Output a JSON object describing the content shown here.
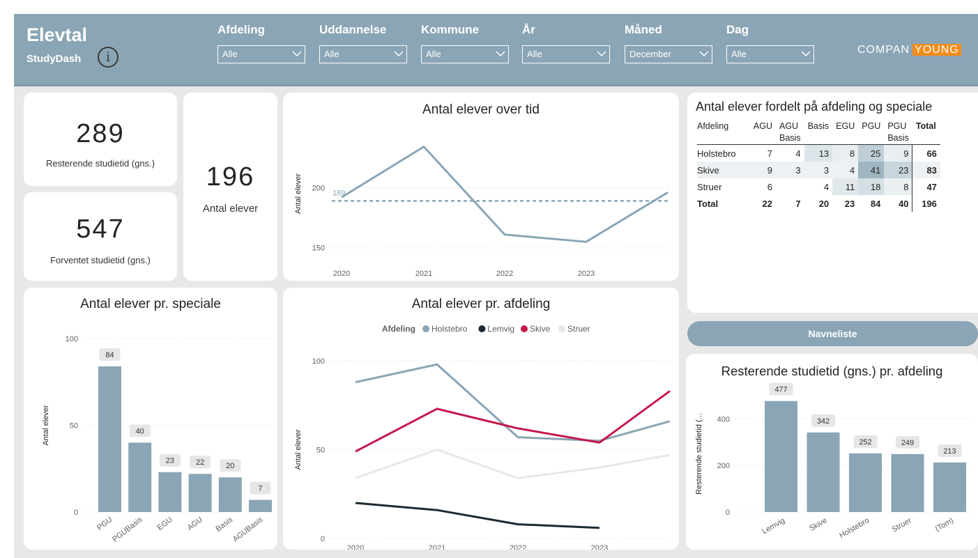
{
  "header": {
    "title": "Elevtal",
    "subtitle": "StudyDash",
    "info_icon": "i",
    "logo_part1": "COMPAN",
    "logo_part2": "YOUNG",
    "filters": [
      {
        "label": "Afdeling",
        "value": "Alle"
      },
      {
        "label": "Uddannelse",
        "value": "Alle"
      },
      {
        "label": "Kommune",
        "value": "Alle"
      },
      {
        "label": "År",
        "value": "Alle"
      },
      {
        "label": "Måned",
        "value": "December"
      },
      {
        "label": "Dag",
        "value": "Alle"
      }
    ]
  },
  "kpis": {
    "remaining": {
      "value": "289",
      "label": "Resterende studietid (gns.)"
    },
    "expected": {
      "value": "547",
      "label": "Forventet studietid (gns.)"
    },
    "students": {
      "value": "196",
      "label": "Antal elever"
    }
  },
  "colors": {
    "header": "#8aa5b5",
    "bar": "#8aa5b5",
    "holstebro": "#8aa5b5",
    "lemvig": "#1b2a32",
    "skive": "#c4174a",
    "struer": "#e3e9e9"
  },
  "matrix": {
    "title": "Antal elever fordelt på afdeling og speciale",
    "row_header": "Afdeling",
    "columns": [
      "AGU",
      "AGU Basis",
      "Basis",
      "EGU",
      "PGU",
      "PGU Basis",
      "Total"
    ],
    "rows": [
      {
        "name": "Holstebro",
        "values": [
          "7",
          "4",
          "13",
          "8",
          "25",
          "9",
          "66"
        ],
        "shade": [
          0,
          0,
          0.25,
          0.1,
          0.6,
          0.1,
          0
        ]
      },
      {
        "name": "Skive",
        "values": [
          "9",
          "3",
          "3",
          "4",
          "41",
          "23",
          "83"
        ],
        "shade": [
          0,
          0,
          0,
          0,
          1,
          0.5,
          0
        ]
      },
      {
        "name": "Struer",
        "values": [
          "6",
          "",
          "4",
          "11",
          "18",
          "8",
          "47"
        ],
        "shade": [
          0,
          0,
          0,
          0.2,
          0.35,
          0.08,
          0
        ]
      },
      {
        "name": "Total",
        "values": [
          "22",
          "7",
          "20",
          "23",
          "84",
          "40",
          "196"
        ],
        "shade": [
          0,
          0,
          0,
          0,
          0,
          0,
          0
        ]
      }
    ]
  },
  "nav_button": "Navneliste",
  "chart_data": [
    {
      "id": "over_time",
      "type": "line",
      "title": "Antal elever over tid",
      "ylabel": "Antal elever",
      "xlabel": "",
      "x": [
        "2020",
        "2021",
        "2022",
        "2023"
      ],
      "values": [
        192,
        234,
        161,
        155
      ],
      "end_value": 196,
      "reference_value": 189,
      "reference_label": "189",
      "ylim": [
        140,
        250
      ],
      "yticks": [
        150,
        200
      ],
      "grid": true
    },
    {
      "id": "per_speciale",
      "type": "bar",
      "title": "Antal elever pr. speciale",
      "ylabel": "Antal elever",
      "xlabel": "",
      "categories": [
        "PGU",
        "PGUBasis",
        "EGU",
        "AGU",
        "Basis",
        "AGUBasis"
      ],
      "values": [
        84,
        40,
        23,
        22,
        20,
        7
      ],
      "ylim": [
        0,
        100
      ],
      "yticks": [
        0,
        50,
        100
      ],
      "grid": true
    },
    {
      "id": "per_afdeling",
      "type": "line",
      "title": "Antal elever pr. afdeling",
      "ylabel": "Antal elever",
      "xlabel": "",
      "legend_title": "Afdeling",
      "legend_position": "top",
      "x": [
        "2020",
        "2021",
        "2022",
        "2023"
      ],
      "series": [
        {
          "name": "Holstebro",
          "values": [
            88,
            98,
            57,
            55
          ],
          "end_value": 66
        },
        {
          "name": "Lemvig",
          "values": [
            20,
            16,
            8,
            6
          ],
          "end_value": null
        },
        {
          "name": "Skive",
          "values": [
            49,
            73,
            62,
            54
          ],
          "end_value": 83
        },
        {
          "name": "Struer",
          "values": [
            34,
            50,
            34,
            40
          ],
          "end_value": 47
        }
      ],
      "ylim": [
        0,
        100
      ],
      "yticks": [
        0,
        50,
        100
      ],
      "grid": true
    },
    {
      "id": "rest_per_afdeling",
      "type": "bar",
      "title": "Resterende studietid (gns.) pr. afdeling",
      "ylabel": "Resterende studietid (...",
      "xlabel": "",
      "categories": [
        "Lemvig",
        "Skive",
        "Holstebro",
        "Struer",
        "(Tom)"
      ],
      "values": [
        477,
        342,
        252,
        249,
        213
      ],
      "ylim": [
        0,
        500
      ],
      "yticks": [
        0,
        200,
        400
      ],
      "grid": true
    }
  ]
}
